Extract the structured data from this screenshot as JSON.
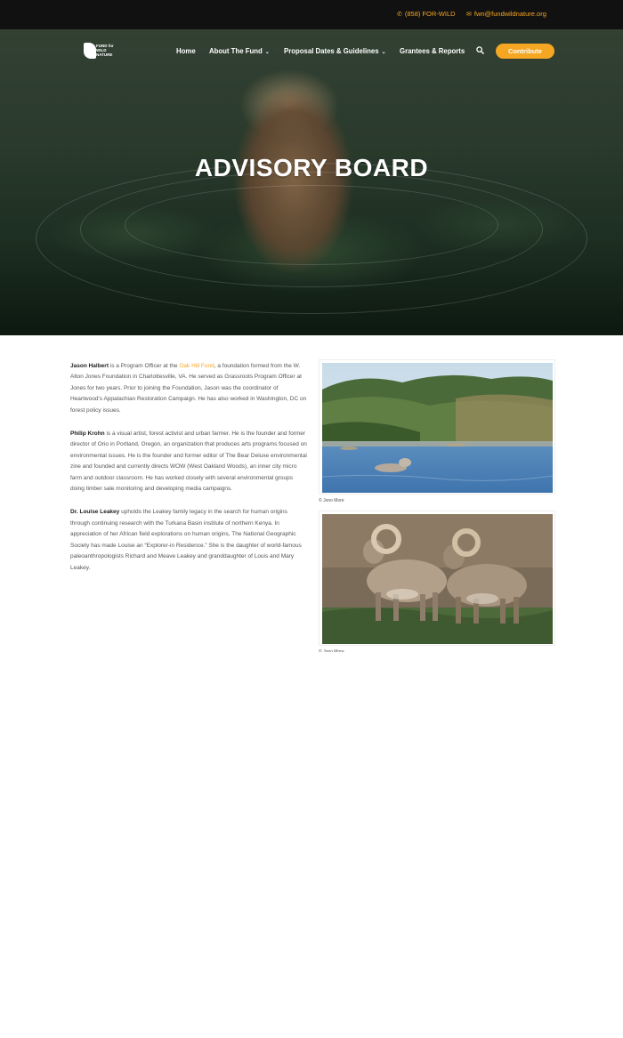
{
  "topbar": {
    "phone": "(858) FOR-WILD",
    "email": "fwn@fundwildnature.org",
    "phone_icon": "phone-icon",
    "email_icon": "envelope-icon"
  },
  "logo": {
    "line1": "FUND for",
    "line2": "WILD",
    "line3": "NATURE"
  },
  "nav": {
    "items": [
      {
        "label": "Home"
      },
      {
        "label": "About The Fund"
      },
      {
        "label": "Proposal Dates & Guidelines"
      },
      {
        "label": "Grantees & Reports"
      }
    ],
    "contribute": "Contribute"
  },
  "hero": {
    "title": "ADVISORY BOARD"
  },
  "bios": [
    {
      "name": "Jason Halbert",
      "pre_link": " is a Program Officer at the ",
      "link": "Oak Hill Fund",
      "post_link": ", a foundation formed from the W. Alton Jones Foundation in Charlottesville, VA. He served as Grassroots Program Officer at Jones for two years. Prior to joining the Foundation, Jason was the coordinator of Heartwood’s Appalachian Restoration Campaign. He has also worked in Washington, DC on forest policy issues."
    },
    {
      "name": "Philip Krohn",
      "text": " is a visual artist, forest activist and urban farmer. He is the founder and former director of Orio in Portland, Oregon, an organization that produces arts programs focused on environmental issues. He is the founder and former editor of The Bear Deluxe environmental zine and founded and currently directs WOW (West Oakland Woods), an inner city micro farm and outdoor classroom. He has worked closely with several environmental groups doing timber sale monitoring and developing media campaigns."
    },
    {
      "name": "Dr. Louise Leakey",
      "text": " upholds the Leakey family legacy in the search for human origins through continuing research with the Turkana Basin institute of northern Kenya. In appreciation of her African field explorations on human origins, The National Geographic Society has made Louise an “Explorer-in Residence.” She is the daughter of world-famous paleoanthropologists Richard and Meave Leakey and granddaughter of Louis and Mary Leakey."
    }
  ],
  "figures": [
    {
      "caption": "© Jono More"
    },
    {
      "caption": "© Jono More"
    }
  ]
}
